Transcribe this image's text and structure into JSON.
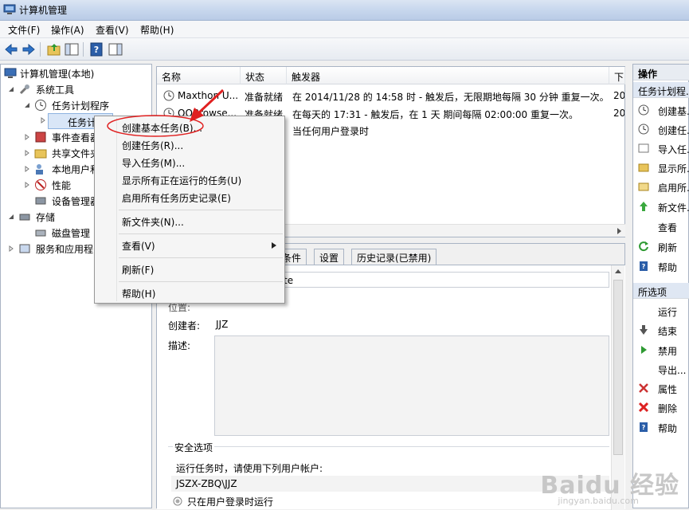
{
  "window": {
    "title": "计算机管理"
  },
  "menubar": [
    "文件(F)",
    "操作(A)",
    "查看(V)",
    "帮助(H)"
  ],
  "toolbar": [
    "back-icon",
    "forward-icon",
    "up-folder-icon",
    "show-hide-tree-icon",
    "help-icon",
    "show-hide-action-pane-icon"
  ],
  "tree": {
    "root": "计算机管理(本地)",
    "system_tools": "系统工具",
    "task_scheduler": "任务计划程序",
    "task_library": "任务计",
    "event_viewer": "事件查看器",
    "shared_folders": "共享文件夹",
    "local_users": "本地用户和",
    "performance": "性能",
    "device_manager": "设备管理器",
    "storage": "存储",
    "disk_mgmt": "磁盘管理",
    "services": "服务和应用程"
  },
  "task_list": {
    "columns": [
      "名称",
      "状态",
      "触发器",
      "下"
    ],
    "rows": [
      {
        "name": "Maxthon U...",
        "status": "准备就绪",
        "trigger": "在 2014/11/28 的 14:58 时 - 触发后，无限期地每隔 30 分钟 重复一次。",
        "next": "20"
      },
      {
        "name": "QQBrowse...",
        "status": "准备就绪",
        "trigger": "在每天的 17:31 - 触发后，在 1 天 期间每隔 02:00:00 重复一次。",
        "next": "20"
      },
      {
        "name": "",
        "status": "",
        "trigger": "当任何用户登录时",
        "next": ""
      }
    ]
  },
  "detail": {
    "tabs": [
      "条件",
      "设置",
      "历史记录(已禁用)"
    ],
    "name_value_fragment": "te",
    "location_label": "位置:",
    "author_label": "创建者:",
    "author_value": "JJZ",
    "description_label": "描述:",
    "security_group": "安全选项",
    "run_as_text": "运行任务时，请使用下列用户帐户:",
    "account": "JSZX-ZBQ\\JJZ",
    "radio_logged_on": "只在用户登录时运行"
  },
  "context_menu": {
    "items": [
      "创建基本任务(B)...",
      "创建任务(R)...",
      "导入任务(M)...",
      "显示所有正在运行的任务(U)",
      "启用所有任务历史记录(E)",
      "新文件夹(N)...",
      "查看(V)",
      "刷新(F)",
      "帮助(H)"
    ]
  },
  "actions": {
    "header": "操作",
    "section1": "任务计划程...",
    "section1_items": [
      {
        "label": "创建基...",
        "icon": "create-basic-task-icon"
      },
      {
        "label": "创建任...",
        "icon": "create-task-icon"
      },
      {
        "label": "导入任...",
        "icon": "import-task-icon"
      },
      {
        "label": "显示所...",
        "icon": "show-running-icon"
      },
      {
        "label": "启用所...",
        "icon": "enable-history-icon"
      },
      {
        "label": "新文件...",
        "icon": "new-folder-icon"
      },
      {
        "label": "查看",
        "icon": ""
      },
      {
        "label": "刷新",
        "icon": "refresh-icon"
      },
      {
        "label": "帮助",
        "icon": "help-icon"
      }
    ],
    "section2": "所选项",
    "section2_items": [
      {
        "label": "运行",
        "icon": ""
      },
      {
        "label": "结束",
        "icon": "end-icon"
      },
      {
        "label": "禁用",
        "icon": "disable-icon"
      },
      {
        "label": "导出...",
        "icon": ""
      },
      {
        "label": "属性",
        "icon": "properties-icon"
      },
      {
        "label": "删除",
        "icon": "delete-icon"
      },
      {
        "label": "帮助",
        "icon": "help-icon"
      }
    ]
  },
  "watermark": {
    "brand": "Baidu 经验",
    "url": "jingyan.baidu.com"
  },
  "colors": {
    "highlight_ring": "#e02020",
    "selection": "#cce8ff",
    "title_bar": "#c9d8ee"
  }
}
